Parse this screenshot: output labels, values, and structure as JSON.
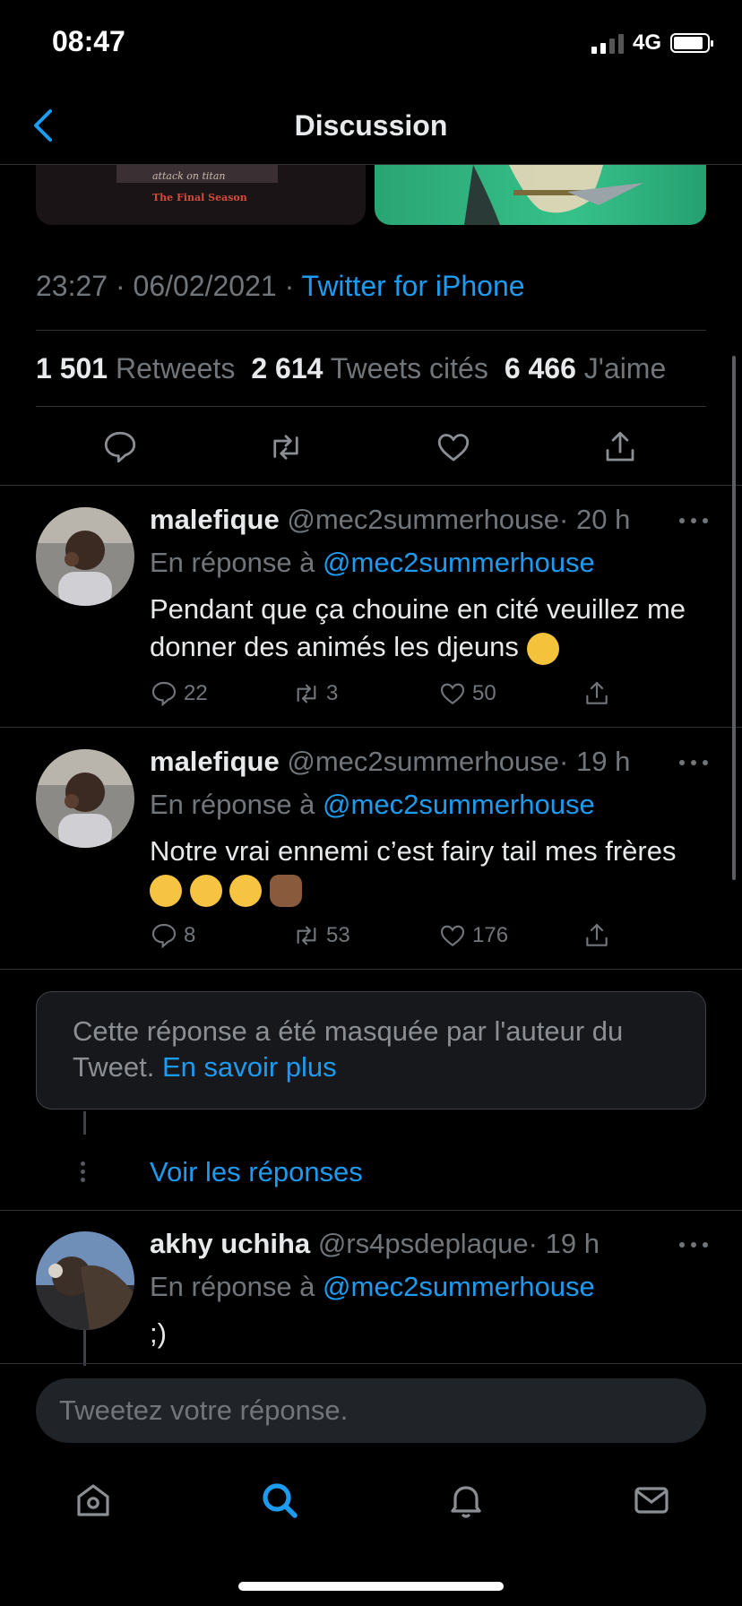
{
  "status_bar": {
    "time": "08:47",
    "network": "4G"
  },
  "header": {
    "title": "Discussion"
  },
  "media": {
    "left_subtitle": "attack on titan",
    "left_title": "The Final Season"
  },
  "tweet": {
    "time": "23:27",
    "date": "06/02/2021",
    "separator": "·",
    "source": "Twitter for iPhone",
    "stats": [
      {
        "value": "1 501",
        "label": "Retweets"
      },
      {
        "value": "2 614",
        "label": "Tweets cités"
      },
      {
        "value": "6 466",
        "label": "J'aime"
      }
    ]
  },
  "replies": [
    {
      "name": "malefique",
      "handle": "@mec2summerhouse",
      "time": "· 20 h",
      "reply_prefix": "En réponse à",
      "reply_to": "@mec2summerhouse",
      "text": "Pendant que ça chouine en cité veuillez me donner des animés les djeuns",
      "counts": {
        "replies": "22",
        "retweets": "3",
        "likes": "50"
      }
    },
    {
      "name": "malefique",
      "handle": "@mec2summerhouse",
      "time": "· 19 h",
      "reply_prefix": "En réponse à",
      "reply_to": "@mec2summerhouse",
      "text": "Notre vrai ennemi c’est fairy tail mes frères",
      "counts": {
        "replies": "8",
        "retweets": "53",
        "likes": "176"
      }
    },
    {
      "name": "akhy uchiha",
      "handle": "@rs4psdeplaque",
      "time": "· 19 h",
      "reply_prefix": "En réponse à",
      "reply_to": "@mec2summerhouse",
      "text": ";)"
    }
  ],
  "hidden_notice": {
    "text": "Cette réponse a été masquée par l'auteur du Tweet.",
    "link": "En savoir plus"
  },
  "see_replies": "Voir les réponses",
  "composer": {
    "placeholder": "Tweetez votre réponse."
  },
  "colors": {
    "accent": "#1d9bf0",
    "background": "#000000",
    "muted": "#71767b"
  },
  "icons": [
    "back-chevron-icon",
    "reply-icon",
    "retweet-icon",
    "like-icon",
    "share-icon",
    "more-icon",
    "home-icon",
    "search-icon",
    "notifications-icon",
    "messages-icon"
  ]
}
